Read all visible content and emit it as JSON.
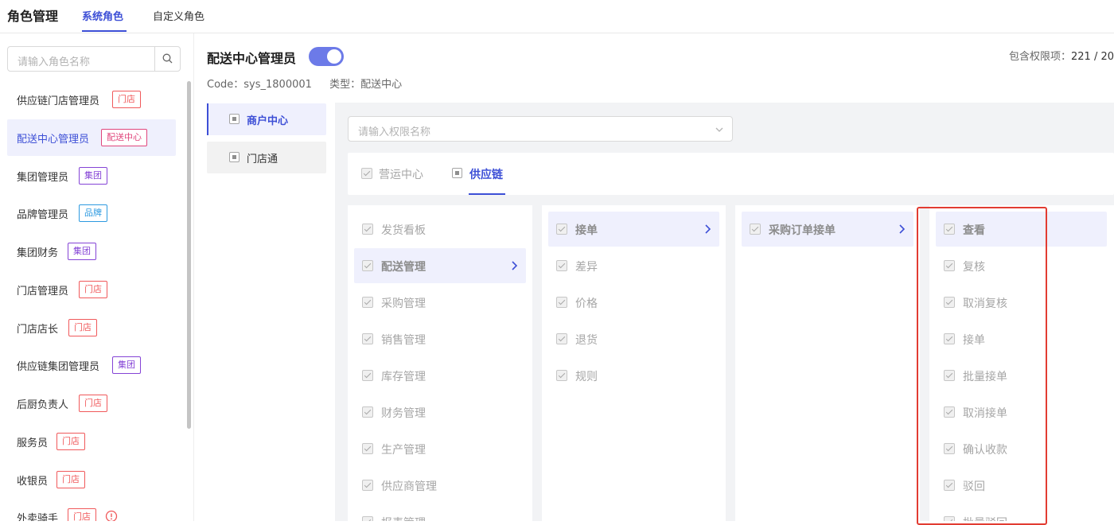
{
  "topbar": {
    "title": "角色管理",
    "tabs": [
      {
        "label": "系统角色",
        "active": true
      },
      {
        "label": "自定义角色",
        "active": false
      }
    ]
  },
  "sidebar": {
    "search_placeholder": "请输入角色名称",
    "roles": [
      {
        "name": "供应链门店管理员",
        "tag": "门店",
        "tag_type": "store"
      },
      {
        "name": "配送中心管理员",
        "tag": "配送中心",
        "tag_type": "dist",
        "active": true
      },
      {
        "name": "集团管理员",
        "tag": "集团",
        "tag_type": "group"
      },
      {
        "name": "品牌管理员",
        "tag": "品牌",
        "tag_type": "brand"
      },
      {
        "name": "集团财务",
        "tag": "集团",
        "tag_type": "group"
      },
      {
        "name": "门店管理员",
        "tag": "门店",
        "tag_type": "store"
      },
      {
        "name": "门店店长",
        "tag": "门店",
        "tag_type": "store"
      },
      {
        "name": "供应链集团管理员",
        "tag": "集团",
        "tag_type": "group"
      },
      {
        "name": "后厨负责人",
        "tag": "门店",
        "tag_type": "store"
      },
      {
        "name": "服务员",
        "tag": "门店",
        "tag_type": "store"
      },
      {
        "name": "收银员",
        "tag": "门店",
        "tag_type": "store"
      },
      {
        "name": "外卖骑手",
        "tag": "门店",
        "tag_type": "store",
        "warning": true
      }
    ]
  },
  "role": {
    "title": "配送中心管理员",
    "enabled": true,
    "perm_count_label": "包含权限项：",
    "perm_count_value": "221 / 20",
    "code_label": "Code：sys_1800001",
    "type_label": "类型：配送中心"
  },
  "apps": [
    {
      "label": "商户中心",
      "active": true
    },
    {
      "label": "门店通",
      "active": false
    }
  ],
  "perm_search_placeholder": "请输入权限名称",
  "modules": [
    {
      "label": "营运中心",
      "active": false
    },
    {
      "label": "供应链",
      "active": true
    }
  ],
  "columns": {
    "col1": [
      "发货看板",
      "配送管理",
      "采购管理",
      "销售管理",
      "库存管理",
      "财务管理",
      "生产管理",
      "供应商管理",
      "报表管理"
    ],
    "col2": [
      "接单",
      "差异",
      "价格",
      "退货",
      "规则"
    ],
    "col3": [
      "采购订单接单"
    ],
    "col4": [
      "查看",
      "复核",
      "取消复核",
      "接单",
      "批量接单",
      "取消接单",
      "确认收款",
      "驳回",
      "批量驳回"
    ]
  },
  "colors": {
    "accent": "#3d4fd6",
    "highlight": "#e23c32",
    "store_tag": "#f0595b",
    "dist_tag": "#e0467c",
    "group_tag": "#8544d6",
    "brand_tag": "#2d9ae0"
  }
}
